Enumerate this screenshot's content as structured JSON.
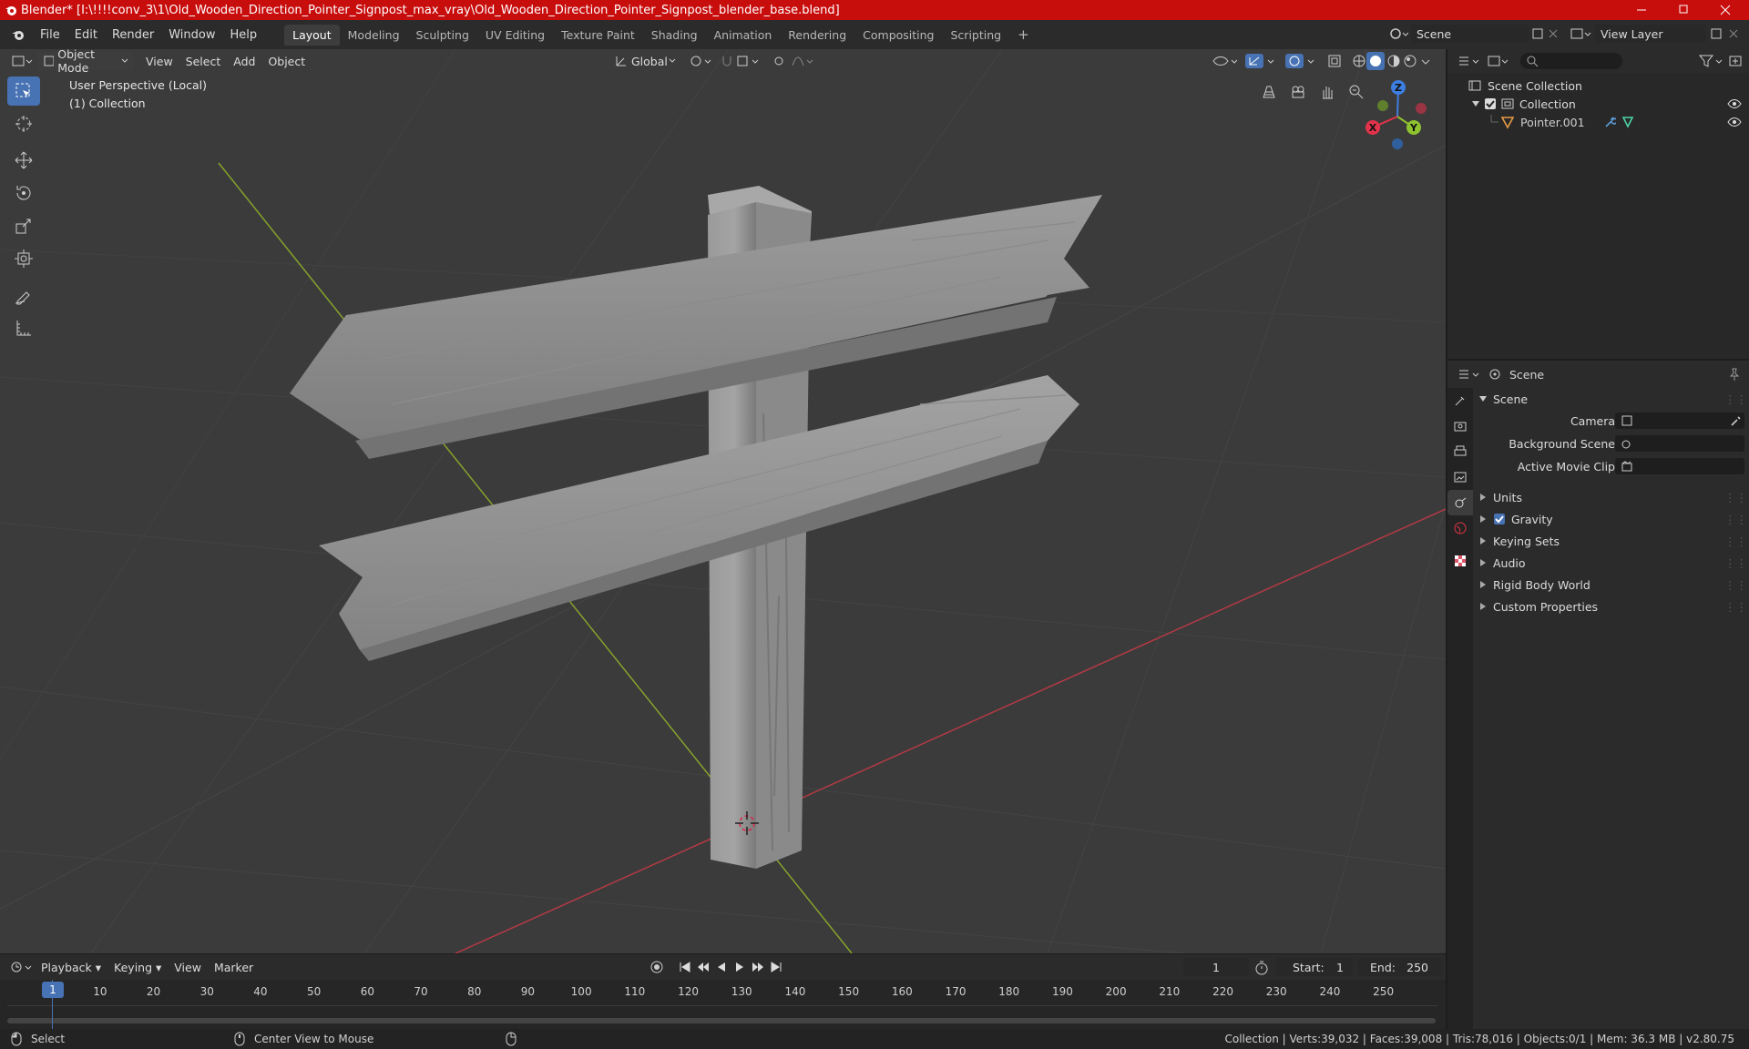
{
  "window": {
    "title": "Blender* [I:\\!!!!conv_3\\1\\Old_Wooden_Direction_Pointer_Signpost_max_vray\\Old_Wooden_Direction_Pointer_Signpost_blender_base.blend]",
    "accent": "#c80d0d"
  },
  "menu": [
    "File",
    "Edit",
    "Render",
    "Window",
    "Help"
  ],
  "workspaces": [
    "Layout",
    "Modeling",
    "Sculpting",
    "UV Editing",
    "Texture Paint",
    "Shading",
    "Animation",
    "Rendering",
    "Compositing",
    "Scripting"
  ],
  "active_workspace": "Layout",
  "scene_selector": {
    "value": "Scene"
  },
  "viewlayer_selector": {
    "value": "View Layer"
  },
  "viewport": {
    "mode": "Object Mode",
    "menus": [
      "View",
      "Select",
      "Add",
      "Object"
    ],
    "orientation": "Global",
    "info_line1": "User Perspective (Local)",
    "info_line2": "(1) Collection"
  },
  "gizmo": {
    "x": "X",
    "y": "Y",
    "z": "Z"
  },
  "outliner": {
    "root": "Scene Collection",
    "collection": "Collection",
    "object": "Pointer.001"
  },
  "properties": {
    "header": "Scene",
    "panel": "Scene",
    "camera_label": "Camera",
    "background_label": "Background Scene",
    "movieclip_label": "Active Movie Clip",
    "sections": [
      "Units",
      "Gravity",
      "Keying Sets",
      "Audio",
      "Rigid Body World",
      "Custom Properties"
    ],
    "gravity_checked": true
  },
  "timeline": {
    "menus": [
      "Playback",
      "Keying",
      "View",
      "Marker"
    ],
    "current_frame": "1",
    "start_label": "Start:",
    "start_value": "1",
    "end_label": "End:",
    "end_value": "250",
    "ticks": [
      "1",
      "10",
      "20",
      "30",
      "40",
      "50",
      "60",
      "70",
      "80",
      "90",
      "100",
      "110",
      "120",
      "130",
      "140",
      "150",
      "160",
      "170",
      "180",
      "190",
      "200",
      "210",
      "220",
      "230",
      "240",
      "250"
    ]
  },
  "status": {
    "left": "Select",
    "middle": "Center View to Mouse",
    "right": "Collection | Verts:39,032 | Faces:39,008 | Tris:78,016 | Objects:0/1 | Mem: 36.3 MB | v2.80.75"
  }
}
